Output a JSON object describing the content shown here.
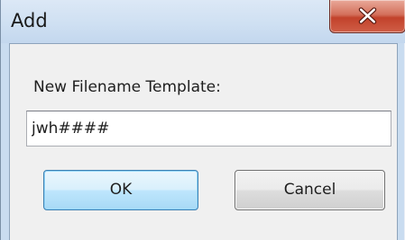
{
  "window": {
    "title": "Add"
  },
  "dialog": {
    "prompt_label": "New Filename Template:",
    "filename_template": {
      "value": "jwh####",
      "placeholder": ""
    },
    "ok_label": "OK",
    "cancel_label": "Cancel"
  },
  "icons": {
    "close": "close-icon"
  },
  "colors": {
    "titlebar": "#cfe0f2",
    "close_button": "#c2422b",
    "dialog_background": "#f0f0f0",
    "default_button_border": "#3c7fb1"
  }
}
